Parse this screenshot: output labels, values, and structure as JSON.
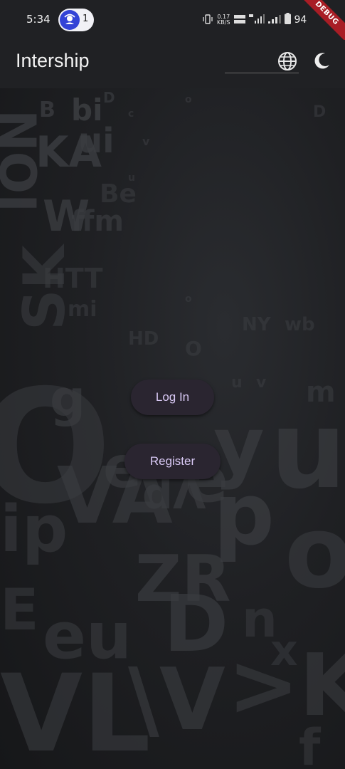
{
  "status_bar": {
    "time": "5:34",
    "hotspot_count": "1",
    "net_speed_value": "0.17",
    "net_speed_unit": "KB/S",
    "battery": "94",
    "debug_banner": "DEBUG"
  },
  "app_bar": {
    "title": "Intership",
    "language_icon": "globe-icon",
    "theme_icon": "moon-icon"
  },
  "main": {
    "login_label": "Log In",
    "register_label": "Register"
  },
  "colors": {
    "app_bar_bg": "#202124",
    "button_bg": "#2a2530",
    "button_text": "#d9c9f5",
    "debug_banner": "#a81d25"
  }
}
